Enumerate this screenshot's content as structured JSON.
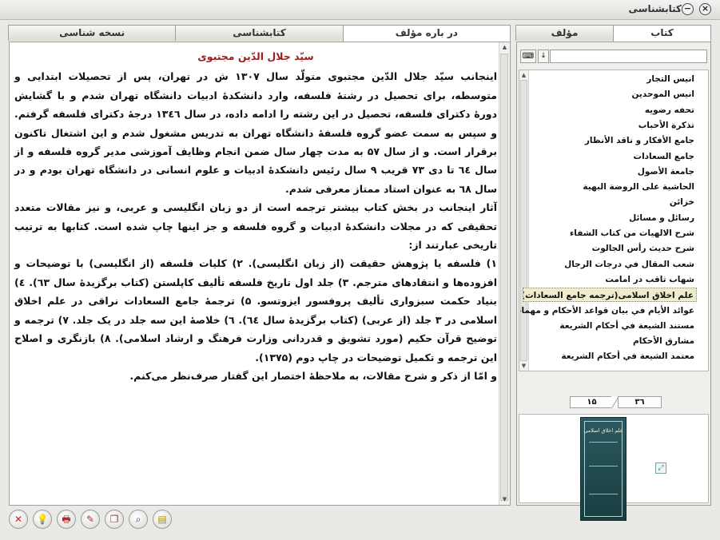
{
  "window": {
    "title": "کتابشناسی"
  },
  "left_tabs": [
    "در باره مؤلف",
    "کتابشناسی",
    "نسخه شناسی"
  ],
  "right_tabs": [
    "مؤلف",
    "کتاب"
  ],
  "document": {
    "heading": "سیّد جلال الدّین مجتبوی",
    "paragraphs": [
      "اینجانب سیّد جلال الدّین مجتبوی متولّد سال ۱۳۰۷ ش در تهران، پس از تحصیلات ابتدایی و متوسطه، برای تحصیل در رشتهٔ فلسفه، وارد دانشکدهٔ ادبیات دانشگاه تهران شدم و با گشایش دورهٔ دکترای فلسفه، تحصیل در این رشته را ادامه داده، در سال ۱۳٤٦ درجهٔ دکترای فلسفه گرفتم. و سپس به سمت عضو گروه فلسفهٔ دانشگاه تهران به تدریس مشغول شدم و این اشتغال تاکنون برقرار است. و از سال ۵۷ به مدت چهار سال ضمن انجام وظایف آموزشی مدیر گروه فلسفه و از سال ٦٤ تا دی ۷۳ قریب ۹ سال رئیس دانشکدهٔ ادبیات و علوم انسانی در دانشگاه تهران بودم و در سال ٦۸ به عنوان استاد ممتاز معرفی شدم.",
      "آثار اینجانب در بخش کتاب بیشتر ترجمه است از دو زبان انگلیسی و عربی، و نیز مقالات متعدد تحقیقی که در مجلات دانشکدهٔ ادبیات و گروه فلسفه و جز اینها چاپ شده است. کتابها به ترتیب تاریخی عبارتند از:",
      "۱) فلسفه یا پژوهش حقیقت (از زبان انگلیسی). ۲) کلیات فلسفه (از انگلیسی) با توضیحات و افزوده‌ها و انتقادهای مترجم. ۳) جلد اول تاریخ فلسفه تألیف کاپلستن (کتاب برگزیدهٔ سال ٦۳). ٤) بنیاد حکمت سبزواری تألیف پروفسور ایزوتسو. ۵) ترجمهٔ جامع السعادات نراقی در علم اخلاق اسلامی در ۳ جلد (از عربی) (کتاب برگزیدهٔ سال ٦٤). ٦) خلاصهٔ این سه جلد در یک جلد. ۷) ترجمه و توضیح قرآن حکیم (مورد تشویق و قدردانی وزارت فرهنگ و ارشاد اسلامی). ۸) بازنگری و اصلاح این ترجمه و تکمیل توضیحات در چاپ دوم (۱۳۷۵).",
      "و امّا از ذکر و شرح مقالات، به ملاحظهٔ اختصار این گفتار صرف‌نظر می‌کنم."
    ]
  },
  "search": {
    "value": ""
  },
  "book_list": {
    "items": [
      "انيس التجار",
      "انيس الموحدين",
      "تحفه رضويه",
      "تذكرة الأحباب",
      "جامع الأفكار و ناقد الأنظار",
      "جامع السعادات",
      "جامعة الأصول",
      "الحاشية على الروضة البهية",
      "خزائن",
      "رسائل و مسائل",
      "شرح الالهيات من كتاب الشفاء",
      "شرح حديث رأس الجالوت",
      "شعب المقال في درجات الرجال",
      "شهاب ثاقب در امامت",
      "علم اخلاق اسلامی(ترجمه جامع السعادات)",
      "عوائد الأيام في بيان قواعد الأحكام و مهمات مسا ...",
      "مستند الشيعة في أحكام الشريعة",
      "مشارق الأحكام",
      "معتمد الشيعة في أحكام الشريعة"
    ],
    "selected_index": 14
  },
  "pager": {
    "current": "۱۵",
    "total": "۳٦"
  },
  "cover": {
    "title": "علم اخلاق اسلامی"
  },
  "toolbar": [
    {
      "name": "close-button",
      "icon": "✕",
      "color": "#c0261e"
    },
    {
      "name": "tip-button",
      "icon": "💡",
      "color": "#b08a00"
    },
    {
      "name": "print-button",
      "icon": "🖶",
      "color": "#a8322a"
    },
    {
      "name": "edit-button",
      "icon": "✎",
      "color": "#a8322a"
    },
    {
      "name": "copy-button",
      "icon": "❐",
      "color": "#a8322a"
    },
    {
      "name": "search-button",
      "icon": "⌕",
      "color": "#1f4f9a"
    },
    {
      "name": "notes-button",
      "icon": "▤",
      "color": "#b08a00"
    }
  ]
}
